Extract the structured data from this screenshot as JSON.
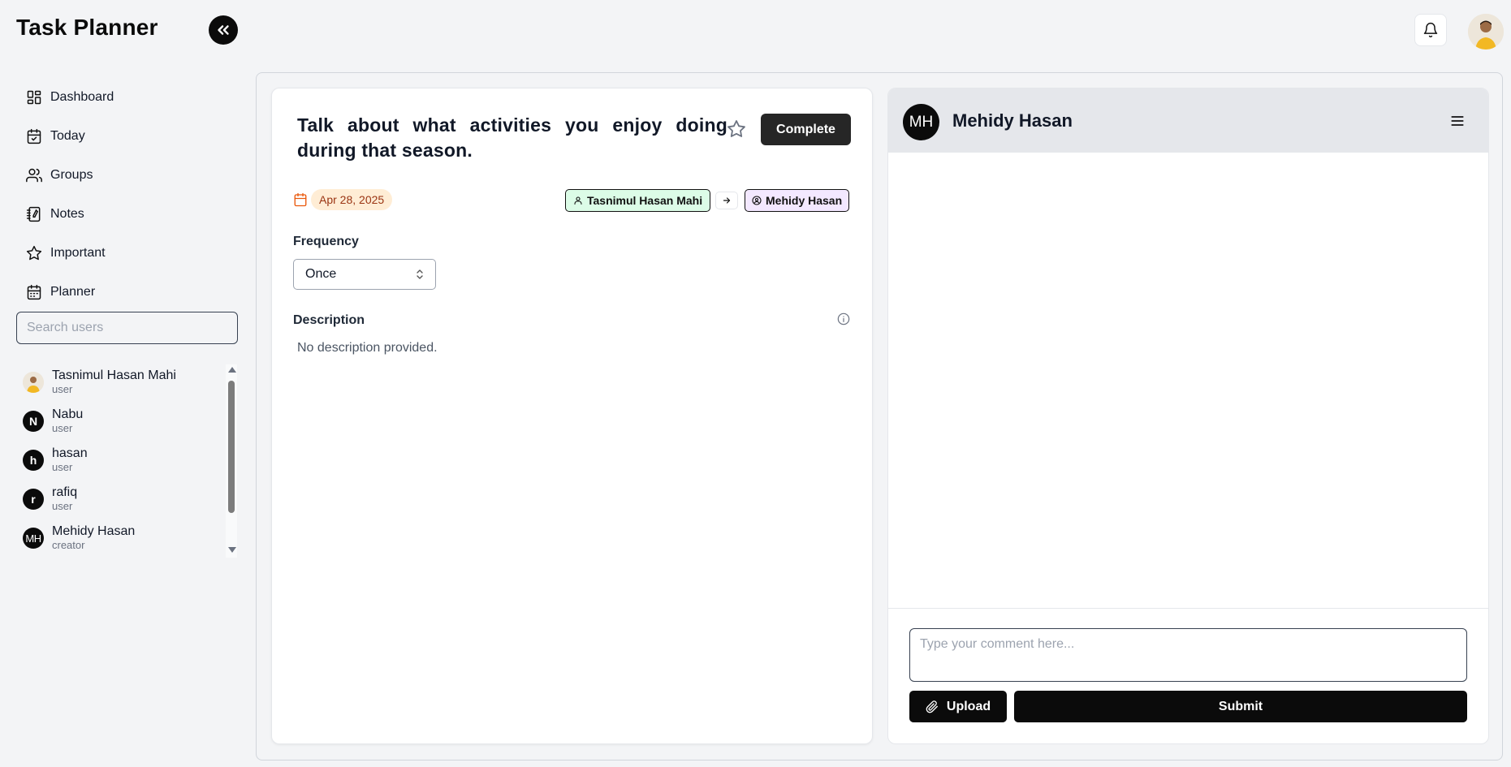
{
  "app": {
    "title": "Task Planner"
  },
  "header": {
    "collapse_icon": "double-chevron-left-icon",
    "bell_icon": "bell-icon",
    "avatar": "user-avatar-photo"
  },
  "sidebar": {
    "items": [
      {
        "label": "Dashboard",
        "icon": "dashboard-icon"
      },
      {
        "label": "Today",
        "icon": "calendar-check-icon"
      },
      {
        "label": "Groups",
        "icon": "users-icon"
      },
      {
        "label": "Notes",
        "icon": "notebook-icon"
      },
      {
        "label": "Important",
        "icon": "star-icon"
      },
      {
        "label": "Planner",
        "icon": "calendar-icon"
      }
    ],
    "search_placeholder": "Search users",
    "users": [
      {
        "name": "Tasnimul Hasan Mahi",
        "role": "user",
        "avatar": "photo"
      },
      {
        "name": "Nabu",
        "role": "user",
        "initial": "N"
      },
      {
        "name": "hasan",
        "role": "user",
        "initial": "h"
      },
      {
        "name": "rafiq",
        "role": "user",
        "initial": "r"
      },
      {
        "name": "Mehidy Hasan",
        "role": "creator",
        "initial": "MH"
      }
    ]
  },
  "task": {
    "title": "Talk about what activities you enjoy doing during that season.",
    "complete_label": "Complete",
    "date": "Apr 28, 2025",
    "assigned_by": "Tasnimul Hasan Mahi",
    "assigned_to": "Mehidy Hasan",
    "frequency_label": "Frequency",
    "frequency_value": "Once",
    "description_label": "Description",
    "description_text": "No description provided.",
    "colors": {
      "date_bg": "#ffedd5",
      "date_text": "#9a3412",
      "from_bg": "#dcfce7",
      "to_bg": "#f3e8ff"
    }
  },
  "comments": {
    "initials": "MH",
    "name": "Mehidy Hasan",
    "input_placeholder": "Type your comment here...",
    "upload_label": "Upload",
    "submit_label": "Submit"
  }
}
